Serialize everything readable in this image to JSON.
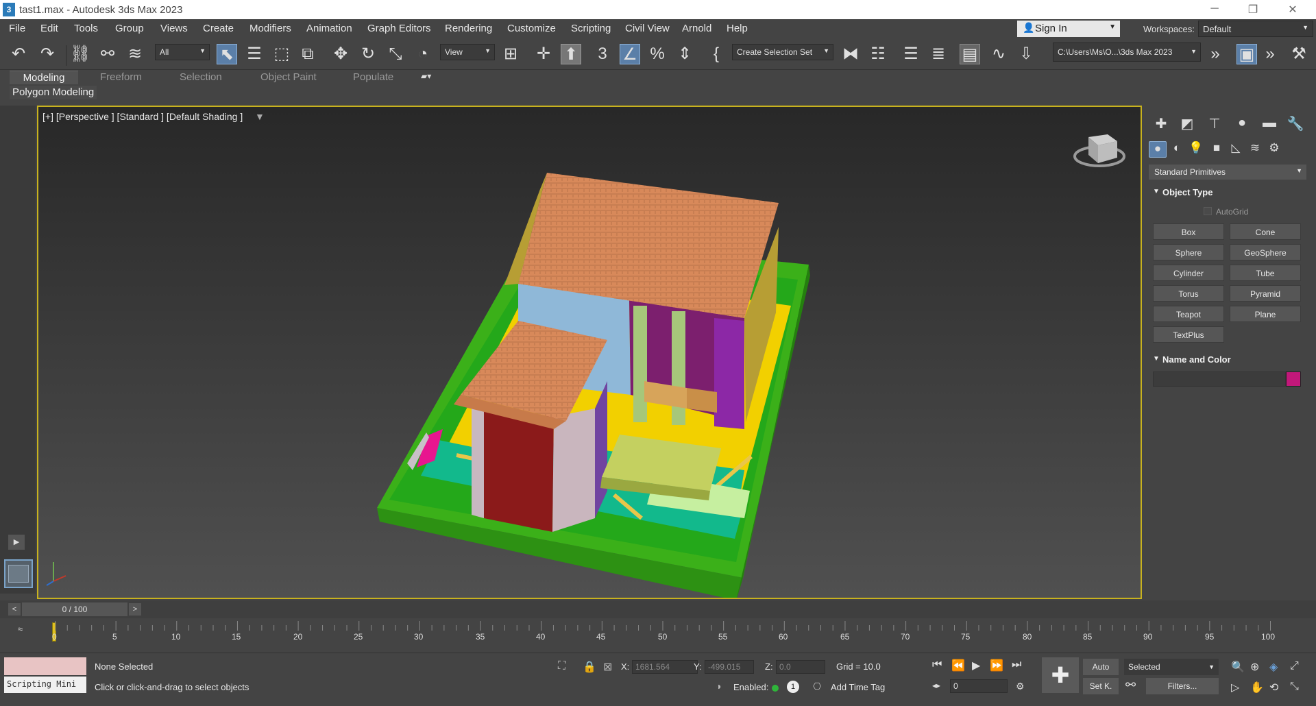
{
  "window": {
    "title": "tast1.max - Autodesk 3ds Max 2023"
  },
  "menu": [
    "File",
    "Edit",
    "Tools",
    "Group",
    "Views",
    "Create",
    "Modifiers",
    "Animation",
    "Graph Editors",
    "Rendering",
    "Customize",
    "Scripting",
    "Civil View",
    "Arnold",
    "Help"
  ],
  "account": {
    "sign_in": "Sign In",
    "workspaces_label": "Workspaces:",
    "workspace": "Default"
  },
  "toolbar": {
    "selection_filter": "All",
    "ref_coord": "View",
    "named_selection": "Create Selection Set",
    "project_path": "C:\\Users\\Ms\\O...\\3ds Max 2023"
  },
  "ribbon": {
    "tabs": [
      "Modeling",
      "Freeform",
      "Selection",
      "Object Paint",
      "Populate"
    ],
    "active": "Modeling",
    "panel": "Polygon Modeling"
  },
  "viewport": {
    "label": "[+] [Perspective ] [Standard ] [Default Shading ]"
  },
  "command_panel": {
    "category": "Standard Primitives",
    "object_type_title": "Object Type",
    "autogrid": "AutoGrid",
    "primitives": [
      "Box",
      "Cone",
      "Sphere",
      "GeoSphere",
      "Cylinder",
      "Tube",
      "Torus",
      "Pyramid",
      "Teapot",
      "Plane",
      "TextPlus"
    ],
    "name_color_title": "Name and Color",
    "swatch_color": "#c2187a"
  },
  "timeline": {
    "slider": "0 / 100",
    "ticks": [
      "0",
      "5",
      "10",
      "15",
      "20",
      "25",
      "30",
      "35",
      "40",
      "45",
      "50",
      "55",
      "60",
      "65",
      "70",
      "75",
      "80",
      "85",
      "90",
      "95",
      "100"
    ]
  },
  "status": {
    "maxscript": "Scripting Mini",
    "selection": "None Selected",
    "prompt": "Click or click-and-drag to select objects",
    "x_label": "X:",
    "x_value": "1681.564",
    "y_label": "Y:",
    "y_value": "-499.015",
    "z_label": "Z:",
    "z_value": "0.0",
    "grid": "Grid = 10.0",
    "enabled": "Enabled:",
    "add_time_tag": "Add Time Tag",
    "frame": "0",
    "auto": "Auto",
    "set_key": "Set K.",
    "key_mode": "Selected",
    "filters": "Filters..."
  }
}
